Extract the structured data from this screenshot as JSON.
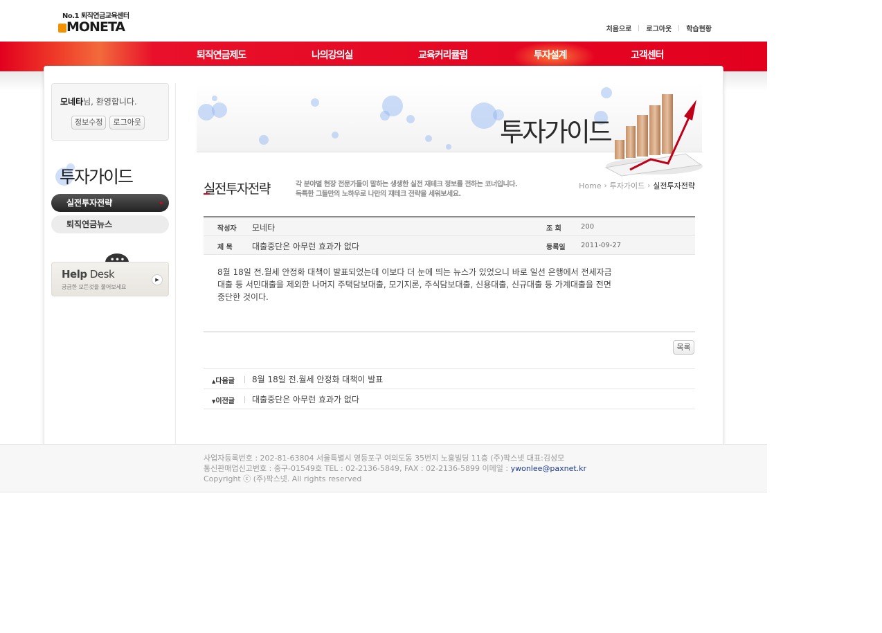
{
  "header": {
    "logo_tag_prefix": "No.1",
    "logo_tag": "퇴직연금교육센터",
    "logo_word": "MONETA",
    "top_links": [
      "처음으로",
      "로그아웃",
      "학습현황"
    ]
  },
  "gnb": {
    "items": [
      "퇴직연금제도",
      "나의강의실",
      "교육커리큘럼",
      "투자설계",
      "고객센터"
    ],
    "active_index": 3
  },
  "sidebar": {
    "user_name": "모네타",
    "welcome_suffix": "님, 환영합니다.",
    "edit_button": "정보수정",
    "logout_button": "로그아웃",
    "section_title": "투자가이드",
    "menu": [
      "실전투자전략",
      "퇴직연금뉴스"
    ],
    "active_menu": 0,
    "helpdesk_title_bold": "Help",
    "helpdesk_title_rest": " Desk",
    "helpdesk_sub": "궁금한 모든것을 물어보세요",
    "helpdesk_bubble": "•••"
  },
  "banner": {
    "title": "투자가이드"
  },
  "page": {
    "title": "실전투자전략",
    "description_line1": "각 분야별 현장 전문가들이 말하는 생생한 실전 재테크 정보를 전하는 코너입니다.",
    "description_line2": "독특한 그들만의 노하우로 나만의 재테크 전략을 세워보세요.",
    "breadcrumb": [
      "Home",
      "투자가이드",
      "실전투자전략"
    ]
  },
  "post": {
    "author_label": "작성자",
    "author": "모네타",
    "views_label": "조  회",
    "views": "200",
    "subject_label": "제  목",
    "subject": "대출중단은 아무런 효과가 없다",
    "date_label": "등록일",
    "date": "2011-09-27",
    "body": "8월 18일 전.월세 안정화 대책이 발표되었는데 이보다 더 눈에 띄는 뉴스가 있었으니 바로 일선 은행에서 전세자금대출 등 서민대출을 제외한 나머지 주택담보대출, 모기지론, 주식담보대출, 신용대출, 신규대출 등 가계대출을 전면 중단한 것이다."
  },
  "actions": {
    "list_button": "목록"
  },
  "nav": {
    "next_label": "다음글",
    "next_title": "8월 18일 전.월세 안정화 대책이 발표",
    "prev_label": "이전글",
    "prev_title": "대출중단은 아무런 효과가 없다"
  },
  "footer": {
    "line1": "사업자등록번호 : 202-81-63804 서울특별시 영등포구 여의도동 35번지 노홍빌딩 11층 (주)팍스넷 대표:김성모",
    "line2_prefix": "통신판매업신고번호 : 중구-01549호 TEL : 02-2136-5849, FAX : 02-2136-5899 이메일 : ",
    "email": "ywonlee@paxnet.kr",
    "line3": "Copyright ⓒ (주)팍스넷. All rights reserved"
  },
  "colors": {
    "brand_red": "#e2001e",
    "logo_orange": "#f39200"
  }
}
